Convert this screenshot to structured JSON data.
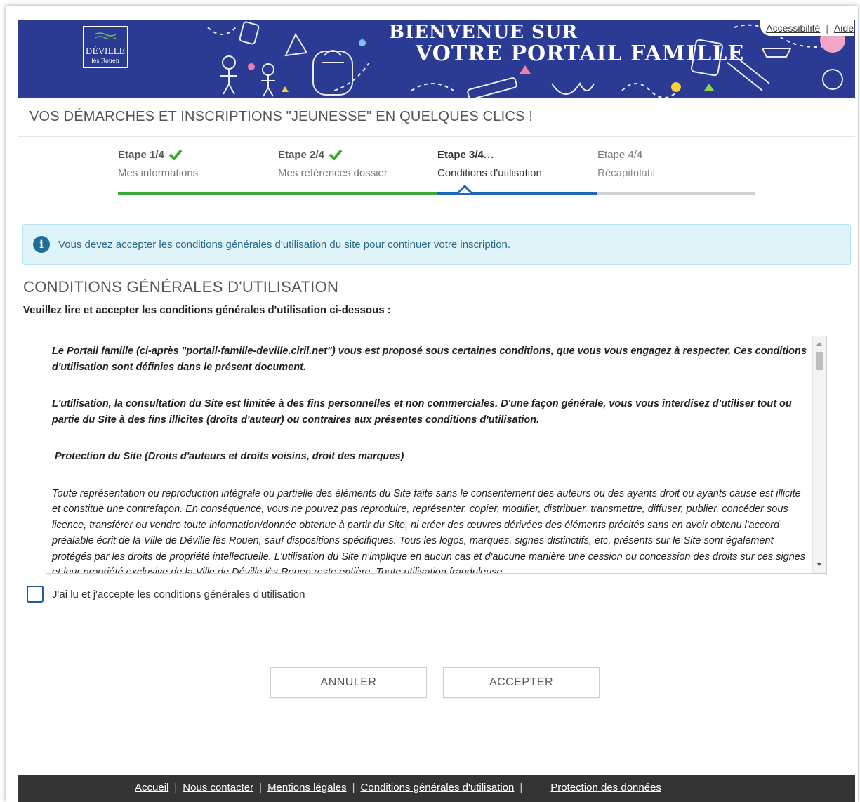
{
  "banner": {
    "logo_name": "DÉVILLE",
    "logo_sub": "lès Rouen",
    "title_line1": "BIENVENUE SUR",
    "title_line2": "VOTRE PORTAIL FAMILLE",
    "links": {
      "accessibility": "Accessibilité",
      "separator": "|",
      "help": "Aide"
    }
  },
  "page_subtitle": "VOS DÉMARCHES ET INSCRIPTIONS \"JEUNESSE\" EN QUELQUES CLICS !",
  "steps": [
    {
      "label": "Etape 1/4",
      "name": "Mes informations",
      "state": "done"
    },
    {
      "label": "Etape 2/4",
      "name": "Mes références dossier",
      "state": "done"
    },
    {
      "label": "Etape 3/4",
      "name": "Conditions d'utilisation",
      "state": "active",
      "indicator": "..."
    },
    {
      "label": "Etape 4/4",
      "name": "Récapitulatif",
      "state": "future"
    }
  ],
  "colors": {
    "banner": "#2b3a92",
    "done": "#3aaa35",
    "active": "#1f66b8",
    "pending": "#d0d0d0",
    "alert_bg": "#dff4f9",
    "footer": "#343434"
  },
  "alert": {
    "icon": "info-icon",
    "message": "Vous devez accepter les conditions générales d'utilisation du site pour continuer votre inscription."
  },
  "section_title": "CONDITIONS GÉNÉRALES D'UTILISATION",
  "lead_text": "Veuillez lire et accepter les conditions générales d'utilisation ci-dessous :",
  "terms": {
    "p1": "Le Portail famille (ci-après \"portail-famille-deville.ciril.net\") vous est proposé sous certaines conditions, que vous vous engagez à respecter. Ces conditions d'utilisation sont définies dans le présent document.",
    "p2": "L'utilisation, la consultation du Site est limitée à des fins personnelles et non commerciales. D'une façon générale, vous vous interdisez d'utiliser tout ou partie du Site à des fins illicites (droits d'auteur) ou contraires aux présentes conditions d'utilisation.",
    "p3": "Protection du Site (Droits d'auteurs et droits voisins, droit des marques)",
    "p4": "Toute représentation ou reproduction intégrale ou partielle des éléments du Site faite sans le consentement des auteurs ou des ayants droit ou ayants cause est illicite et constitue une contrefaçon. En conséquence, vous ne pouvez pas reproduire, représenter, copier, modifier, distribuer, transmettre, diffuser, publier, concéder sous licence, transférer ou vendre toute information/donnée obtenue à partir du Site, ni créer des œuvres dérivées des éléments précités sans en avoir obtenu l'accord préalable écrit de la Ville de Déville lès Rouen, sauf dispositions spécifiques. Tous les logos, marques, signes distinctifs, etc, présents sur le Site sont également protégés par les droits de propriété intellectuelle. L'utilisation du Site n'implique en aucun cas et d'aucune manière une cession ou concession des droits sur ces signes et leur propriété exclusive de la Ville de Déville lès Rouen reste entière. Toute utilisation frauduleuse"
  },
  "checkbox_label": "J'ai lu et j'accepte les conditions générales d'utilisation",
  "buttons": {
    "cancel": "ANNULER",
    "accept": "ACCEPTER"
  },
  "footer": {
    "links": [
      "Accueil",
      "Nous contacter",
      "Mentions légales",
      "Conditions générales d'utilisation",
      "Protection des données"
    ],
    "separator": "|"
  }
}
